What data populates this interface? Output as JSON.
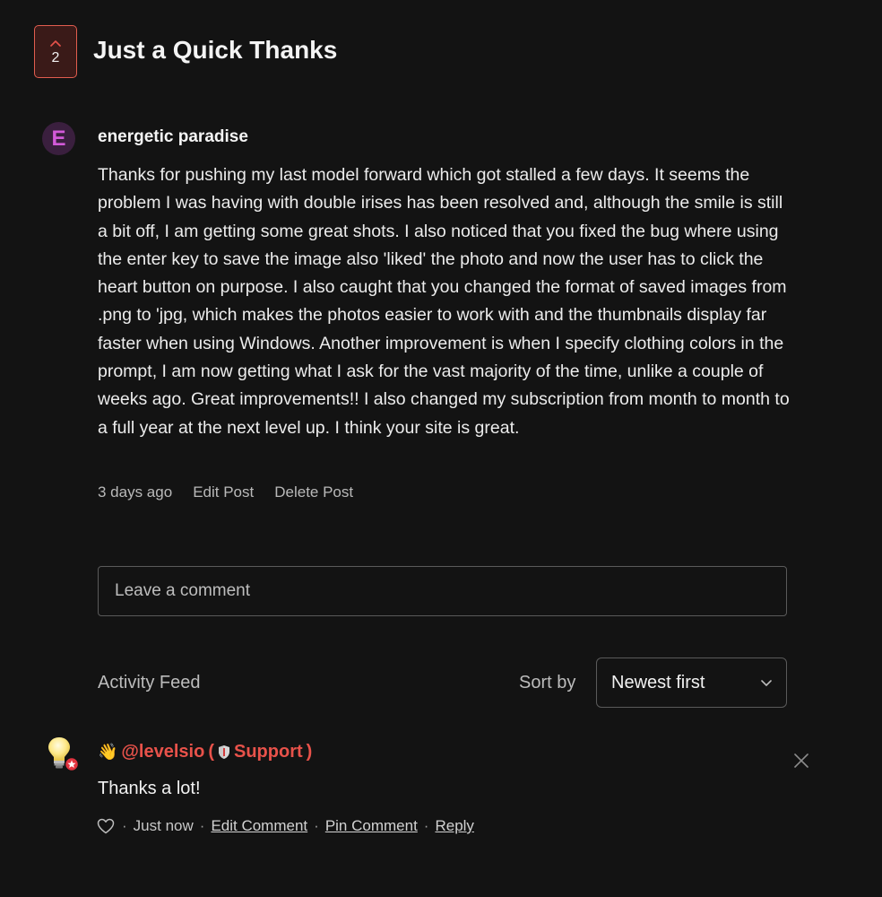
{
  "post": {
    "upvote_count": "2",
    "title": "Just a Quick Thanks",
    "author": {
      "initial": "E",
      "name": "energetic paradise"
    },
    "body": "Thanks for pushing my last model forward which got stalled a few days. It seems the problem I was having with double irises has been resolved and, although the smile is still a bit off, I am getting some great shots. I also noticed that you fixed the bug where using the enter key to save the image also 'liked' the photo and now the user has to click the heart button on purpose. I also caught that you changed the format of saved images from .png to 'jpg, which makes the photos easier to work with and the thumbnails display far faster when using Windows. Another improvement is when I specify clothing colors in the prompt, I am now getting what I ask for the vast majority of the time, unlike a couple of weeks ago. Great improvements!! I also changed my subscription from month to month to a full year at the next level up. I think your site is great.",
    "time": "3 days ago",
    "edit_label": "Edit Post",
    "delete_label": "Delete Post"
  },
  "comment_box": {
    "placeholder": "Leave a comment"
  },
  "feed": {
    "label": "Activity Feed",
    "sort_label": "Sort by",
    "sort_value": "Newest first"
  },
  "comment": {
    "wave_emoji": "👋",
    "author_handle": "@levelsio",
    "role_open": "(",
    "role": "Support",
    "role_close": ")",
    "text": "Thanks a lot!",
    "sep": "·",
    "time": "Just now",
    "edit_label": "Edit Comment",
    "pin_label": "Pin Comment",
    "reply_label": "Reply"
  },
  "colors": {
    "background": "#131313",
    "accent": "#e8524a",
    "upvote_border": "#e25d4f",
    "avatar_letter": "#d35ad9"
  },
  "icons": {
    "upvote": "chevron-up-icon",
    "sort": "chevron-down-icon",
    "close": "close-icon",
    "like": "heart-icon",
    "commenter_avatar": "lightbulb-icon",
    "role_badge": "shield-icon"
  }
}
